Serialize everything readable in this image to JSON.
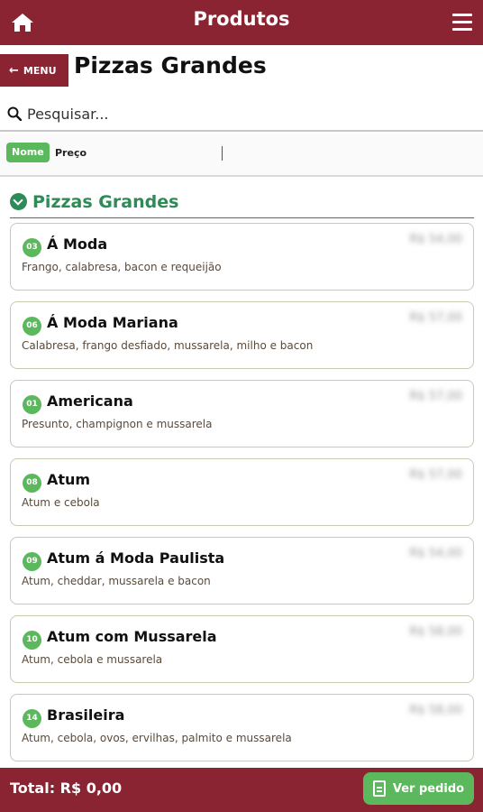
{
  "header": {
    "title": "Produtos",
    "home_icon": "home-icon",
    "menu_icon": "hamburger-menu-icon",
    "color": "#8b2432"
  },
  "back_button": {
    "label": "MENU",
    "icon": "arrow-left-icon"
  },
  "page_title": "Pizzas Grandes",
  "search": {
    "placeholder": "Pesquisar...",
    "value": "",
    "icon": "search-icon"
  },
  "sort": {
    "active": "Nome",
    "other": "Preço"
  },
  "section": {
    "title": "Pizzas Grandes",
    "icon": "chevron-circle-down-icon"
  },
  "items": [
    {
      "num": "03",
      "name": "Á Moda",
      "desc": "Frango, calabresa, bacon e requeijão",
      "price": "R$ 54,00"
    },
    {
      "num": "06",
      "name": "Á Moda Mariana",
      "desc": "Calabresa, frango desfiado, mussarela, milho e bacon",
      "price": "R$ 57,00"
    },
    {
      "num": "01",
      "name": "Americana",
      "desc": "Presunto, champignon e mussarela",
      "price": "R$ 57,00"
    },
    {
      "num": "08",
      "name": "Atum",
      "desc": "Atum e cebola",
      "price": "R$ 57,00"
    },
    {
      "num": "09",
      "name": "Atum á Moda Paulista",
      "desc": "Atum, cheddar, mussarela e bacon",
      "price": "R$ 54,00"
    },
    {
      "num": "10",
      "name": "Atum com Mussarela",
      "desc": "Atum, cebola e mussarela",
      "price": "R$ 58,00"
    },
    {
      "num": "14",
      "name": "Brasileira",
      "desc": "Atum, cebola, ovos, ervilhas, palmito e mussarela",
      "price": "R$ 58,00"
    }
  ],
  "footer": {
    "total": "Total: R$ 0,00",
    "order_button": "Ver pedido",
    "order_icon": "document-icon",
    "button_color": "#5cb85c"
  }
}
